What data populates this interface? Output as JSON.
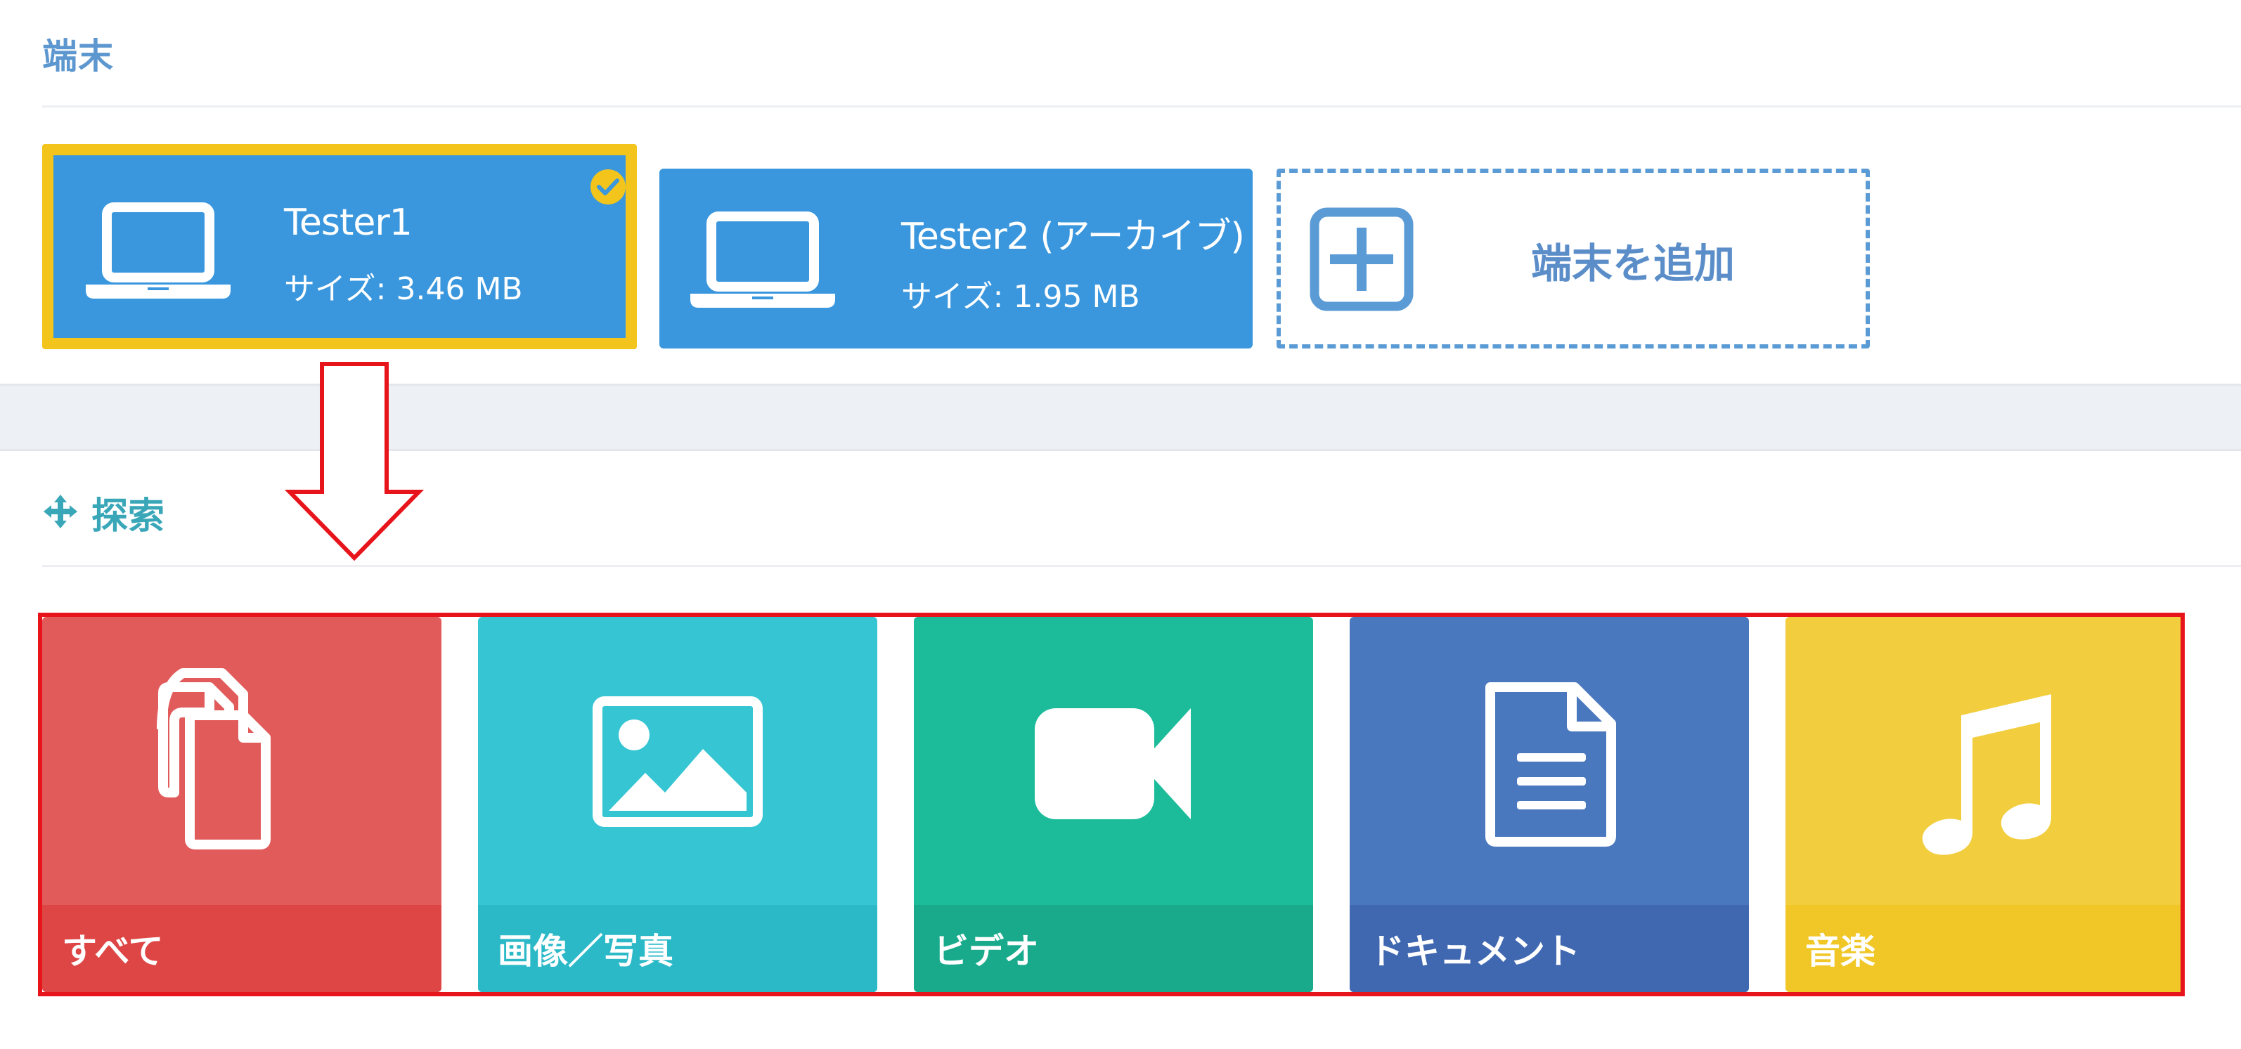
{
  "devices_section": {
    "title": "端末",
    "devices": [
      {
        "name": "Tester1",
        "size": "サイズ: 3.46 MB",
        "selected": true,
        "icon": "laptop-icon"
      },
      {
        "name": "Tester2 (アーカイブ)",
        "size": "サイズ: 1.95 MB",
        "selected": false,
        "icon": "laptop-icon"
      }
    ],
    "add_device_label": "端末を追加"
  },
  "explore_section": {
    "icon": "move-icon",
    "title": "探索",
    "categories": [
      {
        "label": "すべて",
        "icon": "files-icon",
        "color": "#e25b5b",
        "footer_color": "#de4646"
      },
      {
        "label": "画像／写真",
        "icon": "image-icon",
        "color": "#35c5d3",
        "footer_color": "#2bb9c8"
      },
      {
        "label": "ビデオ",
        "icon": "video-camera-icon",
        "color": "#1cbc9b",
        "footer_color": "#18aa8b"
      },
      {
        "label": "ドキュメント",
        "icon": "document-icon",
        "color": "#4a78be",
        "footer_color": "#4068b0"
      },
      {
        "label": "音楽",
        "icon": "music-note-icon",
        "color": "#f2cd3d",
        "footer_color": "#f0c727"
      }
    ]
  },
  "colors": {
    "device_card": "#3a97dd",
    "selected_border": "#f2c41c",
    "highlight_box": "#e8141b",
    "annotation_arrow": "#e8141b"
  }
}
